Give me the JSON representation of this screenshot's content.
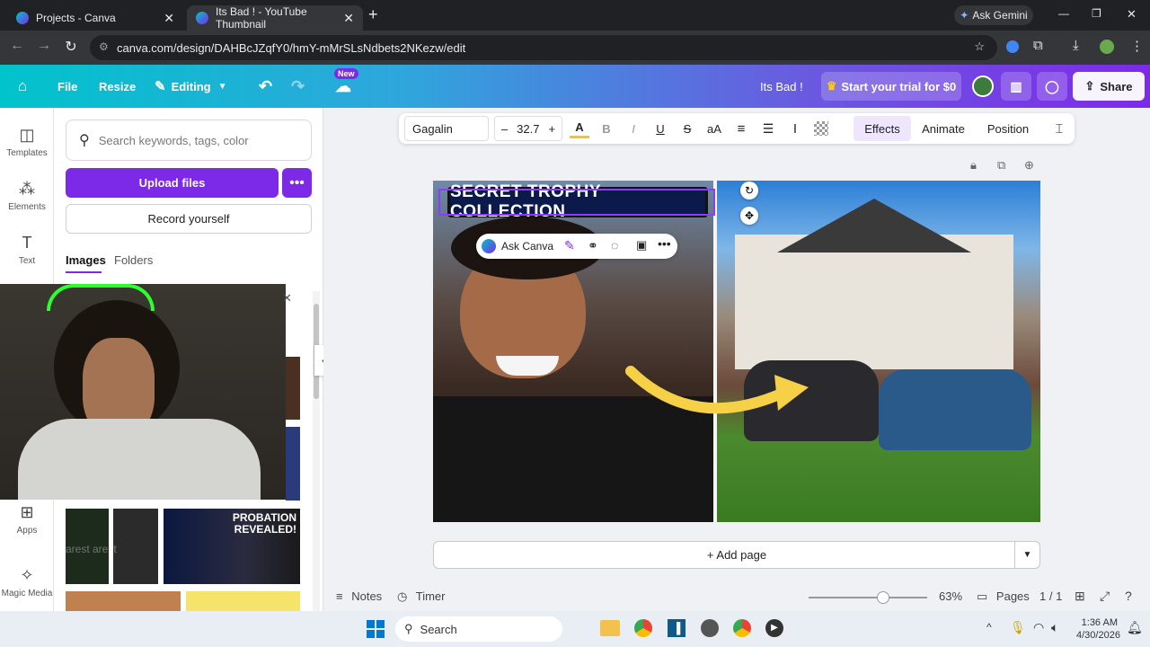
{
  "browser": {
    "tabs": [
      {
        "title": "Projects - Canva",
        "active": false
      },
      {
        "title": "Its Bad ! - YouTube Thumbnail",
        "active": true
      }
    ],
    "ask_gemini": "Ask Gemini",
    "url": "canva.com/design/DAHBcJZqfY0/hmY-mMrSLsNdbets2NKezw/edit"
  },
  "header": {
    "file": "File",
    "resize": "Resize",
    "editing": "Editing",
    "new_badge": "New",
    "doc_title": "Its Bad !",
    "trial": "Start your trial for $0",
    "share": "Share"
  },
  "rail": {
    "items": [
      {
        "label": "Templates",
        "icon": "templates-icon"
      },
      {
        "label": "Elements",
        "icon": "elements-icon"
      },
      {
        "label": "Text",
        "icon": "text-icon"
      },
      {
        "label": "Apps",
        "icon": "apps-icon"
      },
      {
        "label": "Magic Media",
        "icon": "magic-media-icon"
      }
    ]
  },
  "panel": {
    "search_placeholder": "Search keywords, tags, color",
    "upload": "Upload files",
    "record": "Record yourself",
    "tabs": [
      "Images",
      "Folders"
    ],
    "thumb_text": "PROBATION REVEALED!",
    "thumb_faint": "arest arest"
  },
  "toolbar": {
    "font": "Gagalin",
    "minus": "–",
    "font_size": "32.7",
    "plus": "+",
    "color_glyph": "A",
    "bold": "B",
    "italic": "I",
    "underline": "U",
    "strike": "S",
    "case": "aA",
    "effects": "Effects",
    "animate": "Animate",
    "position": "Position"
  },
  "design": {
    "headline": "SECRET TROPHY COLLECTION",
    "ask_canva": "Ask Canva"
  },
  "canvas": {
    "add_page": "+ Add page"
  },
  "footer": {
    "notes": "Notes",
    "timer": "Timer",
    "zoom": "63%",
    "zoom_level": 0.63,
    "pages": "Pages",
    "page_count": "1 / 1"
  },
  "taskbar": {
    "search": "Search",
    "time": "1:36 AM",
    "date": "4/30/2026"
  },
  "colors": {
    "accent": "#7d2ae8",
    "teal": "#01c3cc",
    "headline_bg": "#0b1a4a"
  }
}
